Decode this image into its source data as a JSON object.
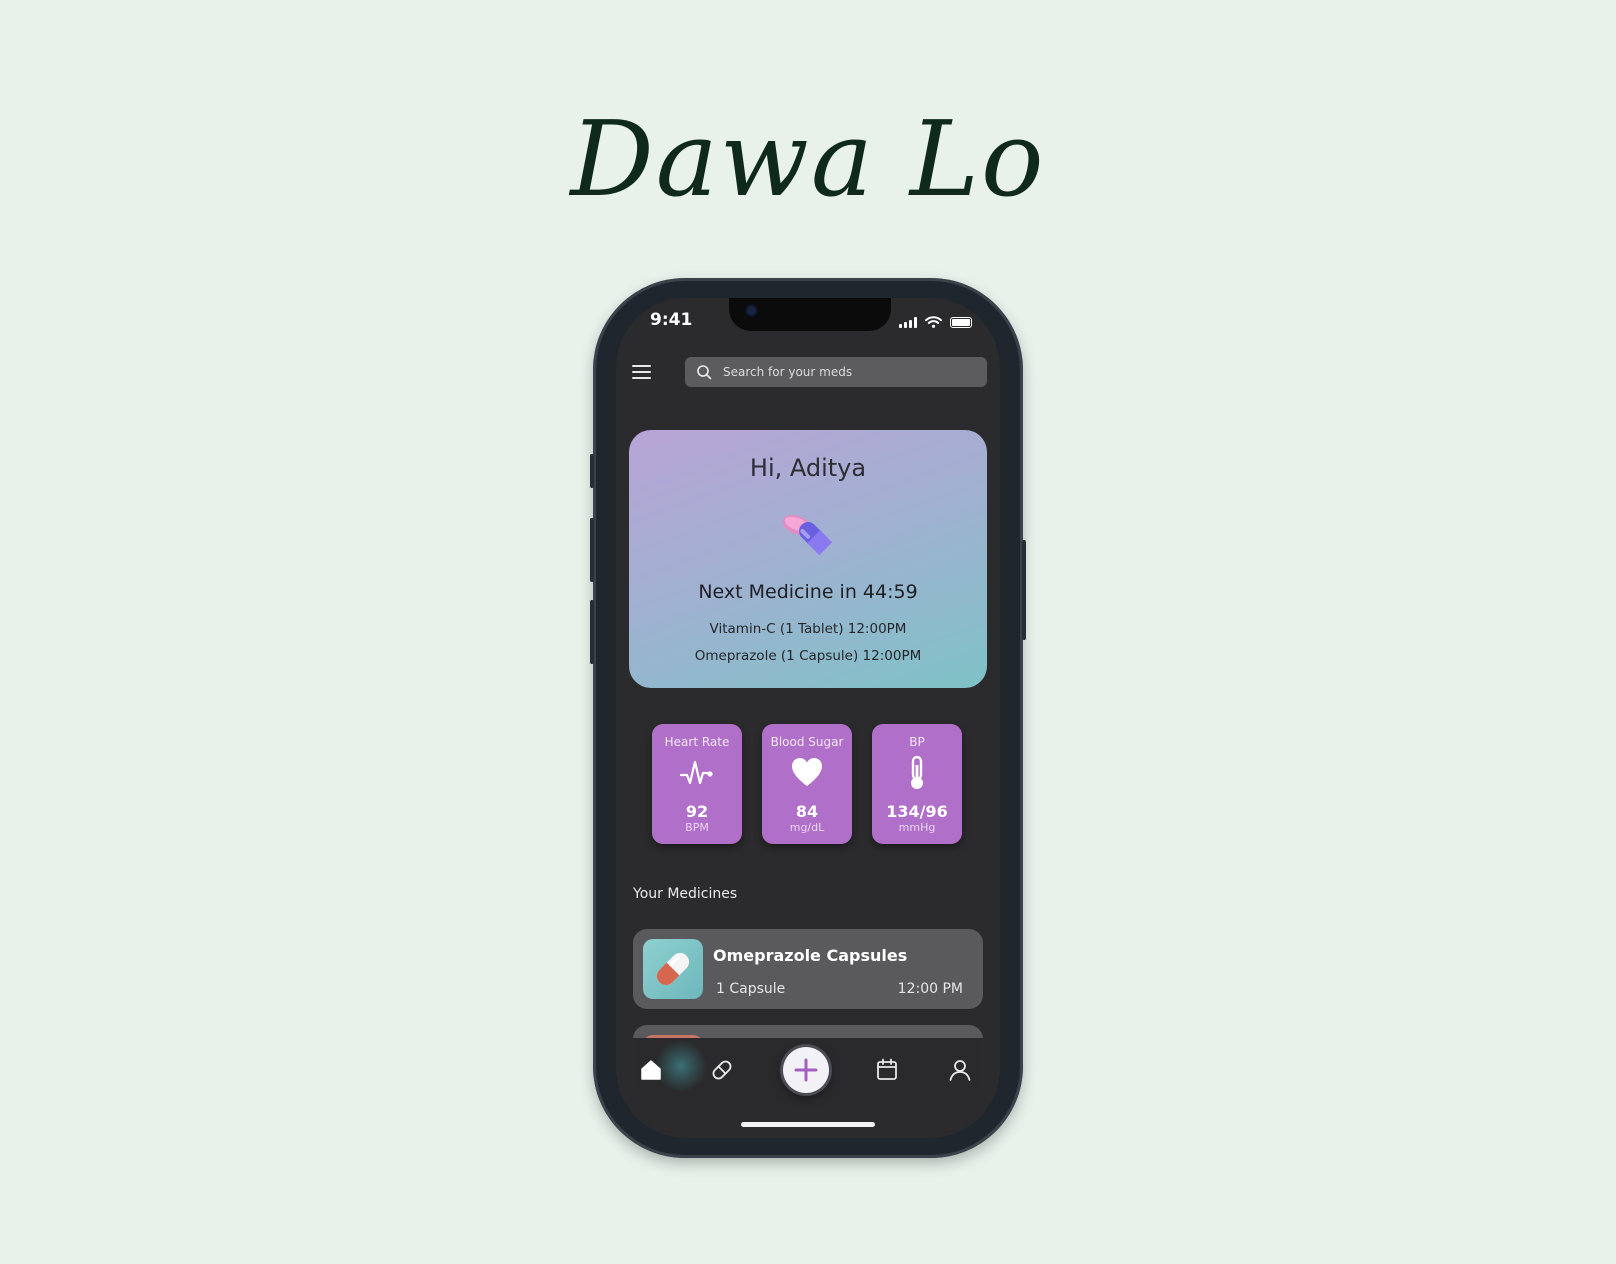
{
  "brand": {
    "title": "Dawa Lo"
  },
  "status_bar": {
    "time": "9:41"
  },
  "search": {
    "placeholder": "Search for your meds"
  },
  "hero": {
    "greeting": "Hi, Aditya",
    "next_medicine": "Next Medicine in 44:59",
    "upcoming": [
      "Vitamin-C (1 Tablet) 12:00PM",
      "Omeprazole (1 Capsule) 12:00PM"
    ]
  },
  "vitals": [
    {
      "title": "Heart Rate",
      "icon": "heart-rate-icon",
      "value": "92",
      "unit": "BPM"
    },
    {
      "title": "Blood Sugar",
      "icon": "heart-icon",
      "value": "84",
      "unit": "mg/dL"
    },
    {
      "title": "BP",
      "icon": "thermometer-icon",
      "value": "134/96",
      "unit": "mmHg"
    }
  ],
  "medicines": {
    "section_title": "Your Medicines",
    "items": [
      {
        "name": "Omeprazole Capsules",
        "dose": "1 Capsule",
        "time": "12:00 PM"
      }
    ]
  },
  "nav": {
    "items": [
      "home-icon",
      "pill-icon",
      "add-icon",
      "calendar-icon",
      "profile-icon"
    ],
    "active": "home-icon"
  },
  "colors": {
    "page_bg": "#e8f2eb",
    "screen_bg": "#2b2b2d",
    "vital_card": "#b06fc9",
    "accent": "#a45fc0"
  }
}
